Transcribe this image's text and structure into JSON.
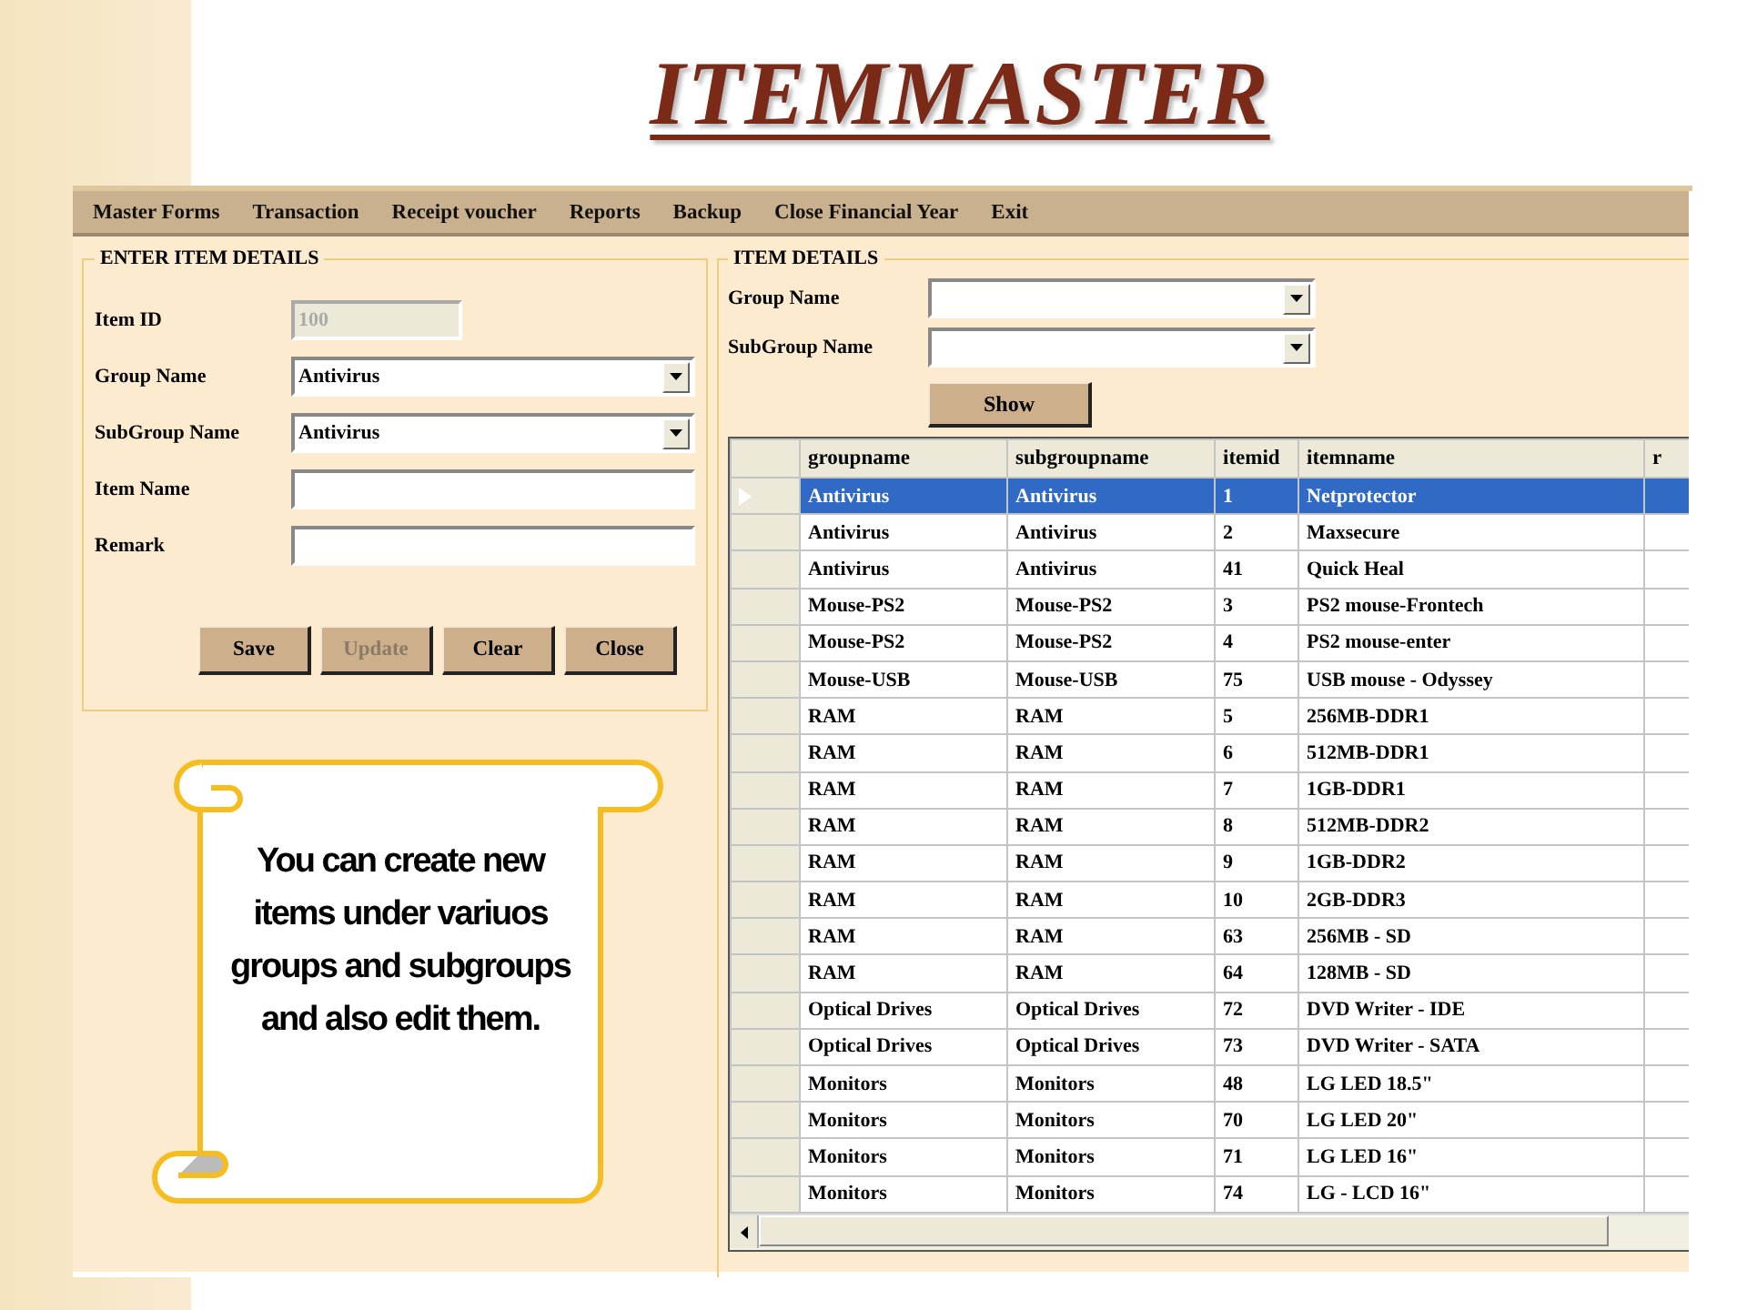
{
  "slide_title": "ITEMMASTER",
  "menu": [
    "Master Forms",
    "Transaction",
    "Receipt voucher",
    "Reports",
    "Backup",
    "Close Financial Year",
    "Exit"
  ],
  "enter_item_details": {
    "title": "ENTER ITEM DETAILS",
    "fields": [
      {
        "label": "Item ID",
        "kind": "text",
        "value": "100",
        "disabled": true
      },
      {
        "label": "Group Name",
        "kind": "dropdown",
        "value": "Antivirus",
        "disabled": false
      },
      {
        "label": "SubGroup Name",
        "kind": "dropdown",
        "value": "Antivirus",
        "disabled": false
      },
      {
        "label": "Item Name",
        "kind": "text",
        "disabled": false
      },
      {
        "label": "Remark",
        "kind": "text",
        "disabled": false
      }
    ],
    "buttons": [
      {
        "label": "Save",
        "disabled": false
      },
      {
        "label": "Update",
        "disabled": true
      },
      {
        "label": "Clear",
        "disabled": false
      },
      {
        "label": "Close",
        "disabled": false
      }
    ]
  },
  "item_details": {
    "title": "ITEM DETAILS",
    "filters": [
      {
        "label": "Group Name",
        "kind": "dropdown"
      },
      {
        "label": "SubGroup Name",
        "kind": "dropdown"
      }
    ],
    "show_button": "Show",
    "table": {
      "columns": [
        "groupname",
        "subgroupname",
        "itemid",
        "itemname",
        "r"
      ],
      "rows": [
        {
          "cells": [
            "Antivirus",
            "Antivirus",
            "1",
            "Netprotector"
          ],
          "selected": true
        },
        {
          "cells": [
            "Antivirus",
            "Antivirus",
            "2",
            "Maxsecure"
          ],
          "selected": false
        },
        {
          "cells": [
            "Antivirus",
            "Antivirus",
            "41",
            "Quick Heal"
          ],
          "selected": false
        },
        {
          "cells": [
            "Mouse-PS2",
            "Mouse-PS2",
            "3",
            "PS2 mouse-Frontech"
          ],
          "selected": false
        },
        {
          "cells": [
            "Mouse-PS2",
            "Mouse-PS2",
            "4",
            "PS2 mouse-enter"
          ],
          "selected": false
        },
        {
          "cells": [
            "Mouse-USB",
            "Mouse-USB",
            "75",
            "USB mouse - Odyssey"
          ],
          "selected": false
        },
        {
          "cells": [
            "RAM",
            "RAM",
            "5",
            "256MB-DDR1"
          ],
          "selected": false
        },
        {
          "cells": [
            "RAM",
            "RAM",
            "6",
            "512MB-DDR1"
          ],
          "selected": false
        },
        {
          "cells": [
            "RAM",
            "RAM",
            "7",
            "1GB-DDR1"
          ],
          "selected": false
        },
        {
          "cells": [
            "RAM",
            "RAM",
            "8",
            "512MB-DDR2"
          ],
          "selected": false
        },
        {
          "cells": [
            "RAM",
            "RAM",
            "9",
            "1GB-DDR2"
          ],
          "selected": false
        },
        {
          "cells": [
            "RAM",
            "RAM",
            "10",
            "2GB-DDR3"
          ],
          "selected": false
        },
        {
          "cells": [
            "RAM",
            "RAM",
            "63",
            "256MB - SD"
          ],
          "selected": false
        },
        {
          "cells": [
            "RAM",
            "RAM",
            "64",
            "128MB - SD"
          ],
          "selected": false
        },
        {
          "cells": [
            "Optical Drives",
            "Optical Drives",
            "72",
            "DVD Writer - IDE"
          ],
          "selected": false
        },
        {
          "cells": [
            "Optical Drives",
            "Optical Drives",
            "73",
            "DVD Writer - SATA"
          ],
          "selected": false
        },
        {
          "cells": [
            "Monitors",
            "Monitors",
            "48",
            "LG LED 18.5\""
          ],
          "selected": false
        },
        {
          "cells": [
            "Monitors",
            "Monitors",
            "70",
            "LG LED 20\""
          ],
          "selected": false
        },
        {
          "cells": [
            "Monitors",
            "Monitors",
            "71",
            "LG LED 16\""
          ],
          "selected": false
        },
        {
          "cells": [
            "Monitors",
            "Monitors",
            "74",
            "LG - LCD 16\""
          ],
          "selected": false
        }
      ]
    }
  },
  "callout": {
    "text": "You can create new items under variuos groups and subgroups and also edit them."
  }
}
